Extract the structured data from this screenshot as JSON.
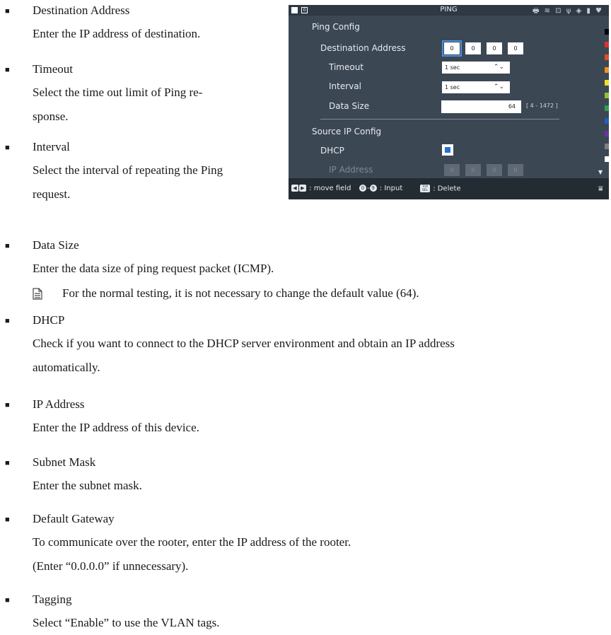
{
  "items": [
    {
      "name": "Destination Address",
      "body": "Enter the IP address of destination."
    },
    {
      "name": "Timeout",
      "body": "Select the time out limit of Ping re-\nsponse."
    },
    {
      "name": "Interval",
      "body": "Select the interval of repeating the Ping\nrequest."
    },
    {
      "name": "Data Size",
      "body": "Enter the data size of ping request packet (ICMP).",
      "note": "For the normal testing, it is not necessary to change the default value (64)."
    },
    {
      "name": "DHCP",
      "body": "Check if you want to connect to the DHCP server environment and obtain an IP address\nautomatically."
    },
    {
      "name": "IP Address",
      "body": "Enter the IP address of this device."
    },
    {
      "name": "Subnet Mask",
      "body": "Enter the subnet mask."
    },
    {
      "name": "Default Gateway",
      "body": "To communicate over the rooter, enter the IP address of the rooter.\n(Enter “0.0.0.0” if unnecessary)."
    },
    {
      "name": "Tagging",
      "body": "Select “Enable” to use the VLAN tags."
    }
  ],
  "screen": {
    "title": "PING",
    "indicator": "0",
    "status_icons": "🖶 ≋ ⊡ ψ ◈ ▮ ♥",
    "ping_config": "Ping Config",
    "dest_label": "Destination Address",
    "dest_octets": [
      "0",
      "0",
      "0",
      "0"
    ],
    "timeout_label": "Timeout",
    "timeout_value": "1 sec",
    "interval_label": "Interval",
    "interval_value": "1 sec",
    "datasize_label": "Data Size",
    "datasize_value": "64",
    "datasize_range": "[ 4 - 1472 ]",
    "source_config": "Source IP Config",
    "dhcp_label": "DHCP",
    "dhcp_checked": true,
    "ip_label": "IP Address",
    "ip_octets": [
      "0",
      "0",
      "0",
      "0"
    ],
    "footer_move": ": move field",
    "footer_key0": "0",
    "footer_key9": "9",
    "footer_input": ": Input",
    "footer_del_top": "TOP",
    "footer_del_bot": "DEL",
    "footer_delete": ": Delete",
    "scroll_colors": [
      "#000000",
      "#e03030",
      "#e05020",
      "#f09020",
      "#f0e020",
      "#90c030",
      "#30a050",
      "#2060c0",
      "#7030a0",
      "#808080",
      "#ffffff"
    ]
  }
}
